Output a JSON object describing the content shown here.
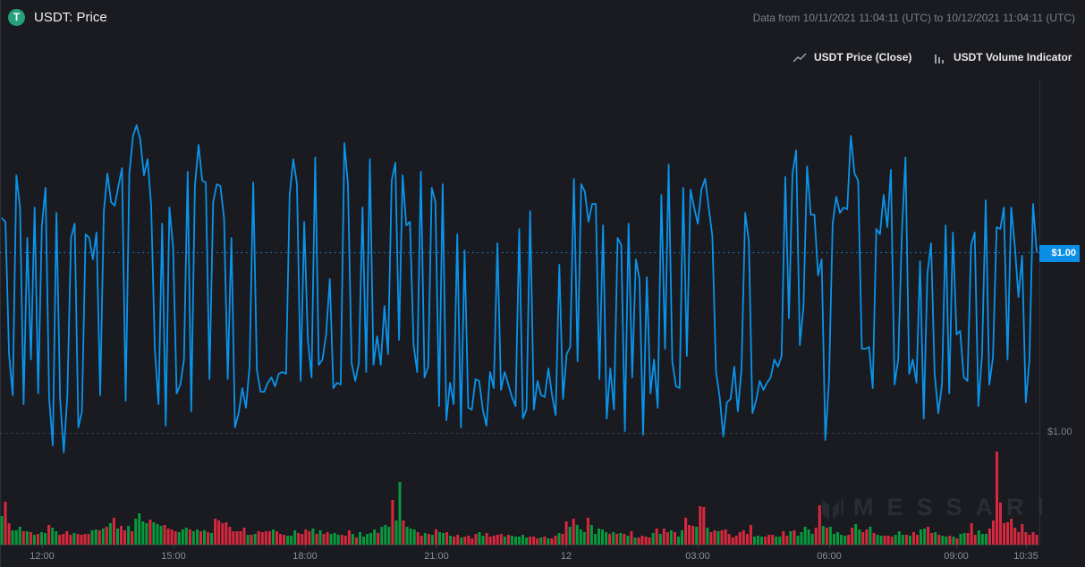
{
  "header": {
    "logo_letter": "T",
    "title": "USDT: Price",
    "date_range": "Data from 10/11/2021 11:04:11 (UTC) to 10/12/2021 11:04:11 (UTC)"
  },
  "legend": {
    "price_icon": "trend-line-icon",
    "price_label": "USDT Price (Close)",
    "volume_icon": "bar-chart-icon",
    "volume_label": "USDT Volume Indicator"
  },
  "watermark": "MESSARI",
  "colors": {
    "background": "#1a1b20",
    "price_line": "#0b93ea",
    "volume_up": "#079a3c",
    "volume_down": "#d8283e",
    "logo": "#26a17b"
  },
  "chart_data": {
    "type": "line",
    "x_ticks": [
      "12:00",
      "15:00",
      "18:00",
      "21:00",
      "12",
      "03:00",
      "06:00",
      "09:00",
      "10:35"
    ],
    "y_ticks": [
      "$1.00"
    ],
    "last_price_label": "$1.00",
    "grid": false,
    "legend_position": "top-right",
    "series": [
      {
        "name": "USDT Price (Close)",
        "type": "line",
        "values": [
          1.0012,
          1.00118,
          1.00044,
          1.00021,
          1.00144,
          1.00126,
          1.00016,
          1.00109,
          1.00041,
          1.00126,
          1.00022,
          1.00116,
          1.00137,
          1.00019,
          0.99993,
          1.00123,
          1.00019,
          0.99989,
          1.00021,
          1.00109,
          1.00117,
          1.00003,
          1.00012,
          1.00111,
          1.00109,
          1.00097,
          1.00112,
          1.00021,
          1.00124,
          1.00145,
          1.00129,
          1.00127,
          1.00138,
          1.00148,
          1.00018,
          1.00145,
          1.00166,
          1.00172,
          1.00164,
          1.00144,
          1.00153,
          1.00127,
          1.00047,
          1.00016,
          1.00117,
          1.00004,
          1.00126,
          1.00104,
          1.00022,
          1.00027,
          1.00041,
          1.00146,
          1.00012,
          1.00138,
          1.00161,
          1.00141,
          1.0014,
          1.0003,
          1.00129,
          1.00139,
          1.00138,
          1.0012,
          1.0003,
          1.00109,
          1.00003,
          1.00011,
          1.00025,
          1.00014,
          1.00037,
          1.0014,
          1.00035,
          1.00023,
          1.00023,
          1.00028,
          1.00031,
          1.00026,
          1.00033,
          1.00034,
          1.00033,
          1.00133,
          1.00153,
          1.00139,
          1.00029,
          1.00118,
          1.00052,
          1.00031,
          1.00154,
          1.00038,
          1.00041,
          1.00055,
          1.00086,
          1.00025,
          1.00028,
          1.00027,
          1.00162,
          1.00139,
          1.00039,
          1.00029,
          1.00039,
          1.00126,
          1.00034,
          1.00153,
          1.00038,
          1.00054,
          1.00038,
          1.00071,
          1.00044,
          1.00141,
          1.00151,
          1.00052,
          1.00144,
          1.00116,
          1.00118,
          1.00049,
          1.00034,
          1.00146,
          1.00031,
          1.00037,
          1.00137,
          1.00129,
          1.00015,
          1.00139,
          1.00007,
          1.00028,
          1.00016,
          1.00111,
          1.00003,
          1.00102,
          1.00014,
          1.00013,
          1.0003,
          1.00029,
          1.00013,
          1.00004,
          1.00034,
          1.00025,
          1.00106,
          1.00024,
          1.00034,
          1.00027,
          1.0002,
          1.00015,
          1.00114,
          1.00008,
          1.00013,
          1.00124,
          1.00013,
          1.00029,
          1.00021,
          1.0002,
          1.00036,
          1.00021,
          1.0001,
          1.00094,
          1.00019,
          1.00044,
          1.00048,
          1.00142,
          1.0004,
          1.00139,
          1.00135,
          1.00118,
          1.00128,
          1.00128,
          1.0003,
          1.00116,
          1.00008,
          1.00036,
          1.00013,
          1.00109,
          1.00105,
          1.00001,
          1.00117,
          1.00031,
          1.00097,
          1.00086,
          0.99999,
          1.00087,
          1.00022,
          1.00041,
          1.00014,
          1.00133,
          1.00047,
          1.0015,
          1.0004,
          1.00026,
          1.00025,
          1.00137,
          1.00043,
          1.00136,
          1.00126,
          1.00117,
          1.00136,
          1.00142,
          1.00126,
          1.0011,
          1.00034,
          1.0002,
          0.99998,
          1.00017,
          1.00019,
          1.00037,
          1.00012,
          1.00036,
          1.00123,
          1.00107,
          1.00011,
          1.00018,
          1.00029,
          1.00024,
          1.00028,
          1.00031,
          1.00041,
          1.00037,
          1.00043,
          1.00143,
          1.00064,
          1.00145,
          1.00158,
          1.00049,
          1.00071,
          1.00149,
          1.00122,
          1.00122,
          1.00088,
          1.00097,
          0.99996,
          1.00029,
          1.00117,
          1.00132,
          1.00123,
          1.00126,
          1.00125,
          1.00166,
          1.00145,
          1.00141,
          1.00047,
          1.00047,
          1.00048,
          1.00025,
          1.00114,
          1.00111,
          1.00133,
          1.00115,
          1.00147,
          1.00027,
          1.00041,
          1.00112,
          1.00154,
          1.00033,
          1.00041,
          1.00028,
          1.00096,
          1.00008,
          1.00089,
          1.00106,
          1.00033,
          1.00011,
          1.00027,
          1.00116,
          1.00022,
          1.00112,
          1.00055,
          1.00057,
          1.00031,
          1.00029,
          1.00105,
          1.00112,
          1.00015,
          1.00044,
          1.0013,
          1.00027,
          1.00042,
          1.00115,
          1.00114,
          1.00126,
          1.00041,
          1.00126,
          1.00104,
          1.00076,
          1.00099,
          1.00017,
          1.00041,
          1.00128,
          1.00101
        ]
      },
      {
        "name": "USDT Volume Indicator",
        "type": "bar",
        "values": [
          32,
          48,
          24,
          16,
          16,
          20,
          15,
          15,
          14,
          11,
          12,
          14,
          13,
          22,
          19,
          15,
          11,
          12,
          15,
          11,
          13,
          12,
          11,
          12,
          12,
          16,
          17,
          16,
          18,
          20,
          24,
          30,
          18,
          21,
          16,
          21,
          15,
          29,
          35,
          26,
          24,
          28,
          25,
          23,
          21,
          22,
          18,
          17,
          15,
          14,
          17,
          19,
          17,
          15,
          17,
          15,
          16,
          14,
          13,
          29,
          27,
          24,
          25,
          20,
          15,
          15,
          15,
          19,
          11,
          11,
          12,
          15,
          14,
          15,
          15,
          17,
          15,
          12,
          11,
          10,
          10,
          16,
          13,
          12,
          17,
          15,
          18,
          12,
          16,
          12,
          14,
          12,
          13,
          11,
          11,
          10,
          16,
          12,
          8,
          14,
          9,
          12,
          13,
          17,
          13,
          20,
          22,
          20,
          50,
          27,
          70,
          27,
          20,
          18,
          17,
          14,
          10,
          13,
          12,
          11,
          17,
          14,
          13,
          14,
          10,
          9,
          11,
          8,
          9,
          10,
          7,
          12,
          14,
          10,
          13,
          9,
          10,
          11,
          12,
          9,
          11,
          10,
          9,
          9,
          11,
          8,
          9,
          9,
          7,
          8,
          9,
          7,
          7,
          10,
          13,
          12,
          26,
          20,
          29,
          22,
          17,
          14,
          30,
          22,
          12,
          18,
          17,
          14,
          12,
          14,
          12,
          13,
          12,
          10,
          15,
          8,
          8,
          10,
          9,
          8,
          13,
          18,
          12,
          18,
          14,
          16,
          14,
          9,
          16,
          30,
          22,
          21,
          20,
          43,
          42,
          19,
          14,
          16,
          15,
          16,
          17,
          12,
          8,
          10,
          14,
          16,
          12,
          22,
          9,
          10,
          9,
          9,
          11,
          11,
          9,
          9,
          15,
          10,
          15,
          16,
          10,
          14,
          20,
          17,
          12,
          19,
          44,
          21,
          19,
          20,
          12,
          14,
          11,
          10,
          11,
          19,
          23,
          17,
          14,
          17,
          20,
          13,
          11,
          10,
          10,
          10,
          9,
          11,
          15,
          11,
          11,
          10,
          14,
          11,
          17,
          18,
          20,
          13,
          14,
          11,
          10,
          9,
          10,
          9,
          7,
          12,
          13,
          13,
          24,
          11,
          16,
          12,
          12,
          18,
          27,
          104,
          47,
          24,
          25,
          29,
          19,
          14,
          23,
          14,
          11,
          14,
          11
        ],
        "direction": "grrgggrgrgrggrggrrrrgrrrrggrgrgrgrrgrggggrgggrrrrgggrggrgrgrrrrrrrrrgrgrrrrgrrrgggrrrrgrgrrgggrrrgrgggggrgggrggrgggrrgrgrggrgrrgrrrrggrrrrrgrgggggrrrgrgrrgrrgrgggrgggggrgrgrgrgrrrrgrgrrgrggrrrgrrgrrgrrrrrrrrrgggrrrggrrgrgggggrrgrgggggrrggrrgrggrrrgggrgrrggrrgrggrgrggrrrggg"
      }
    ]
  }
}
